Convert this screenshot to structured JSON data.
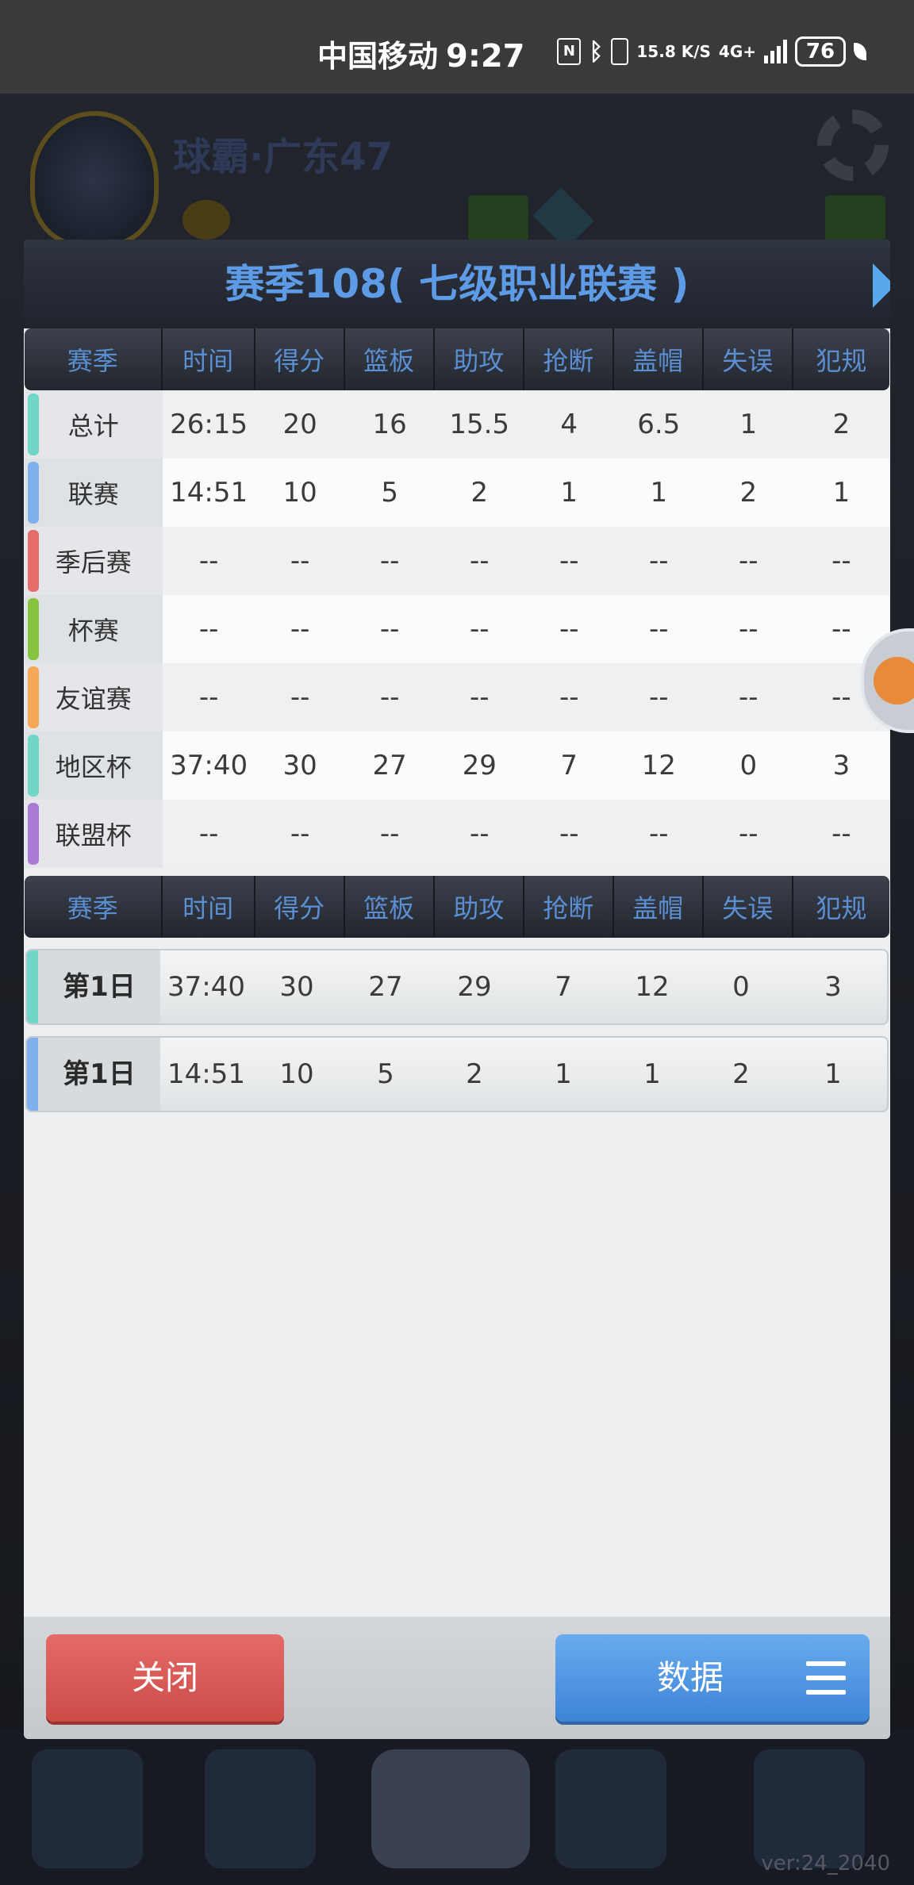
{
  "status_bar": {
    "carrier": "中国移动",
    "time": "9:27",
    "net_speed": "15.8 K/S",
    "network": "4G+",
    "battery": "76"
  },
  "background": {
    "team_name": "球霸·广东47",
    "version": "ver:24_2040"
  },
  "dialog": {
    "title": "赛季108( 七级职业联赛 )",
    "columns": [
      "赛季",
      "时间",
      "得分",
      "篮板",
      "助攻",
      "抢断",
      "盖帽",
      "失误",
      "犯规"
    ],
    "season_rows": [
      {
        "label": "总计",
        "color": "#6fd6c8",
        "values": [
          "26:15",
          "20",
          "16",
          "15.5",
          "4",
          "6.5",
          "1",
          "2"
        ]
      },
      {
        "label": "联赛",
        "color": "#7fb1ee",
        "values": [
          "14:51",
          "10",
          "5",
          "2",
          "1",
          "1",
          "2",
          "1"
        ]
      },
      {
        "label": "季后赛",
        "color": "#e46d6a",
        "values": [
          "--",
          "--",
          "--",
          "--",
          "--",
          "--",
          "--",
          "--"
        ]
      },
      {
        "label": "杯赛",
        "color": "#86c43f",
        "values": [
          "--",
          "--",
          "--",
          "--",
          "--",
          "--",
          "--",
          "--"
        ]
      },
      {
        "label": "友谊赛",
        "color": "#f5a857",
        "values": [
          "--",
          "--",
          "--",
          "--",
          "--",
          "--",
          "--",
          "--"
        ]
      },
      {
        "label": "地区杯",
        "color": "#6fd6c8",
        "values": [
          "37:40",
          "30",
          "27",
          "29",
          "7",
          "12",
          "0",
          "3"
        ]
      },
      {
        "label": "联盟杯",
        "color": "#a97bd6",
        "values": [
          "--",
          "--",
          "--",
          "--",
          "--",
          "--",
          "--",
          "--"
        ]
      }
    ],
    "game_rows": [
      {
        "label": "第1日",
        "color": "#6fd6c8",
        "values": [
          "37:40",
          "30",
          "27",
          "29",
          "7",
          "12",
          "0",
          "3"
        ]
      },
      {
        "label": "第1日",
        "color": "#7fb1ee",
        "values": [
          "14:51",
          "10",
          "5",
          "2",
          "1",
          "1",
          "2",
          "1"
        ]
      }
    ],
    "close_label": "关闭",
    "data_label": "数据"
  }
}
